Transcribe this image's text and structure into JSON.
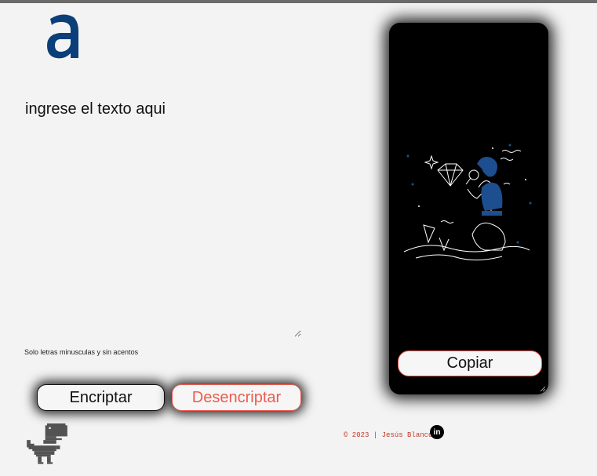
{
  "logo": {
    "icon": "alura-a-logo-icon",
    "color": "#0b3f7a"
  },
  "editor": {
    "placeholder": "ingrese el texto aqui",
    "value": ""
  },
  "hint": "Solo letras minusculas y sin acentos",
  "buttons": {
    "encrypt_label": "Encriptar",
    "decrypt_label": "Desencriptar",
    "copy_label": "Copiar"
  },
  "footer": {
    "credit": "© 2023 | Jesús Blanco",
    "linkedin_label": "in"
  },
  "colors": {
    "accent": "#ee5b4e",
    "panel": "#000000",
    "background": "#f3f3f3",
    "brand_blue": "#0b3f7a"
  }
}
